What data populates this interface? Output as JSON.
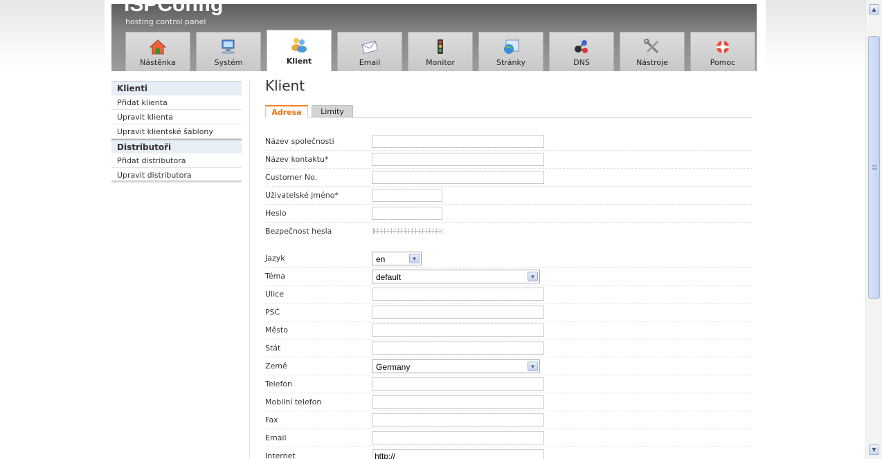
{
  "header": {
    "logo": "ISPConfig",
    "tagline": "hosting control panel"
  },
  "nav": [
    {
      "label": "Nástěnka",
      "icon": "house-icon",
      "active": false
    },
    {
      "label": "Systém",
      "icon": "computer-icon",
      "active": false
    },
    {
      "label": "Klient",
      "icon": "users-icon",
      "active": true
    },
    {
      "label": "Email",
      "icon": "envelope-icon",
      "active": false
    },
    {
      "label": "Monitor",
      "icon": "traffic-light-icon",
      "active": false
    },
    {
      "label": "Stránky",
      "icon": "globe-icon",
      "active": false
    },
    {
      "label": "DNS",
      "icon": "network-icon",
      "active": false
    },
    {
      "label": "Nástroje",
      "icon": "tools-icon",
      "active": false
    },
    {
      "label": "Pomoc",
      "icon": "lifebuoy-icon",
      "active": false
    }
  ],
  "sidebar": {
    "clients_heading": "Klienti",
    "clients_items": [
      "Přidat klienta",
      "Upravit klienta",
      "Upravit klientské šablony"
    ],
    "resellers_heading": "Distributoři",
    "resellers_items": [
      "Přidat distributora",
      "Upravit distributora"
    ]
  },
  "main": {
    "title": "Klient",
    "tabs": [
      {
        "label": "Adresa",
        "active": true
      },
      {
        "label": "Limity",
        "active": false
      }
    ]
  },
  "form": {
    "company_name": {
      "label": "Název společnosti",
      "value": ""
    },
    "contact_name": {
      "label": "Název kontaktu*",
      "value": ""
    },
    "customer_no": {
      "label": "Customer No.",
      "value": ""
    },
    "username": {
      "label": "Uživatelské jméno*",
      "value": ""
    },
    "password": {
      "label": "Heslo",
      "value": ""
    },
    "password_strength": {
      "label": "Bezpečnost hesla"
    },
    "language": {
      "label": "Jazyk",
      "value": "en"
    },
    "theme": {
      "label": "Téma",
      "value": "default"
    },
    "street": {
      "label": "Ulice",
      "value": ""
    },
    "zip": {
      "label": "PSČ",
      "value": ""
    },
    "city": {
      "label": "Město",
      "value": ""
    },
    "state": {
      "label": "Stát",
      "value": ""
    },
    "country": {
      "label": "Země",
      "value": "Germany"
    },
    "telephone": {
      "label": "Telefon",
      "value": ""
    },
    "mobile": {
      "label": "Mobilní telefon",
      "value": ""
    },
    "fax": {
      "label": "Fax",
      "value": ""
    },
    "email": {
      "label": "Email",
      "value": ""
    },
    "internet": {
      "label": "Internet",
      "value": "http://"
    }
  },
  "colors": {
    "accent": "#f58220",
    "sidebar_heading_bg": "#e7eef6"
  }
}
